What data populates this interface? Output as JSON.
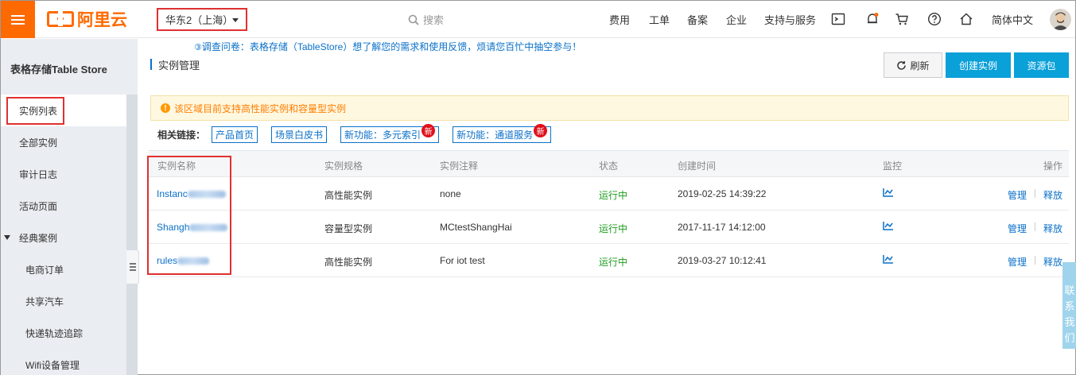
{
  "header": {
    "logo_text": "阿里云",
    "region": "华东2（上海）",
    "search_placeholder": "搜索",
    "nav": [
      "费用",
      "工单",
      "备案",
      "企业",
      "支持与服务"
    ],
    "language": "简体中文"
  },
  "survey": {
    "text": "调查问卷：表格存储（TableStore）想了解您的需求和使用反馈，烦请您百忙中抽空参与！"
  },
  "sidebar": {
    "title": "表格存储Table Store",
    "items": [
      {
        "label": "实例列表",
        "active": true
      },
      {
        "label": "全部实例"
      },
      {
        "label": "审计日志"
      },
      {
        "label": "活动页面"
      },
      {
        "label": "经典案例",
        "expanded": true
      },
      {
        "label": "电商订单"
      },
      {
        "label": "共享汽车"
      },
      {
        "label": "快递轨迹追踪"
      },
      {
        "label": "Wifi设备管理"
      }
    ]
  },
  "main": {
    "title": "实例管理",
    "buttons": {
      "refresh": "刷新",
      "create": "创建实例",
      "package": "资源包"
    },
    "notice": "该区域目前支持高性能实例和容量型实例",
    "links_label": "相关链接：",
    "links": [
      {
        "label": "产品首页",
        "badge": ""
      },
      {
        "label": "场景白皮书",
        "badge": ""
      },
      {
        "label": "新功能：多元索引",
        "badge": "新"
      },
      {
        "label": "新功能：通道服务",
        "badge": "新"
      }
    ],
    "table": {
      "headers": [
        "实例名称",
        "实例规格",
        "实例注释",
        "状态",
        "创建时间",
        "监控",
        "操作"
      ],
      "rows": [
        {
          "name": "Instanc",
          "spec": "高性能实例",
          "note": "none",
          "status": "运行中",
          "created": "2019-02-25 14:39:22"
        },
        {
          "name": "Shangh",
          "spec": "容量型实例",
          "note": "MCtestShangHai",
          "status": "运行中",
          "created": "2017-11-17 14:12:00"
        },
        {
          "name": "rules",
          "spec": "高性能实例",
          "note": "For iot test",
          "status": "运行中",
          "created": "2019-03-27 10:12:41"
        }
      ],
      "actions": [
        "管理",
        "释放"
      ]
    }
  },
  "side_widget": {
    "chars": [
      "联",
      "系",
      "我",
      "们"
    ]
  },
  "colors": {
    "accent": "#ff6a00",
    "primary": "#0aa0d8",
    "link": "#0a70c8",
    "running": "#1e9c1e",
    "highlight": "#e03030"
  }
}
